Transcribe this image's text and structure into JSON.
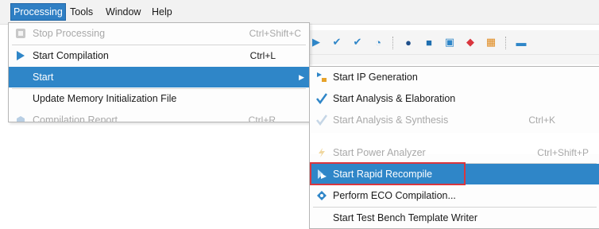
{
  "menubar": {
    "items": [
      "Processing",
      "Tools",
      "Window",
      "Help"
    ]
  },
  "processing_menu": {
    "items": [
      {
        "label": "Stop Processing",
        "shortcut": "Ctrl+Shift+C",
        "icon": "stop-icon",
        "state": "disabled"
      },
      {
        "label": "Start Compilation",
        "shortcut": "Ctrl+L",
        "icon": "play-icon",
        "state": "normal"
      },
      {
        "label": "Start",
        "shortcut": "",
        "icon": "",
        "state": "highlighted",
        "submenu_arrow": "▶"
      },
      {
        "label": "Update Memory Initialization File",
        "shortcut": "",
        "icon": "",
        "state": "normal"
      },
      {
        "label": "Compilation Report",
        "shortcut": "Ctrl+R",
        "icon": "report-icon",
        "state": "disabled"
      }
    ]
  },
  "start_submenu": {
    "items": [
      {
        "label": "Start IP Generation",
        "shortcut": "",
        "icon": "ip-generation-icon",
        "state": "normal"
      },
      {
        "label": "Start Analysis & Elaboration",
        "shortcut": "",
        "icon": "analysis-elaboration-icon",
        "state": "normal"
      },
      {
        "label": "Start Analysis & Synthesis",
        "shortcut": "Ctrl+K",
        "icon": "analysis-synthesis-icon",
        "state": "disabled"
      },
      {
        "label": "Start Power Analyzer",
        "shortcut": "Ctrl+Shift+P",
        "icon": "power-analyzer-icon",
        "state": "disabled"
      },
      {
        "label": "Start Rapid Recompile",
        "shortcut": "",
        "icon": "rapid-recompile-icon",
        "state": "highlighted"
      },
      {
        "label": "Perform ECO Compilation...",
        "shortcut": "",
        "icon": "eco-compilation-icon",
        "state": "normal"
      },
      {
        "label": "Start Test Bench Template Writer",
        "shortcut": "",
        "icon": "",
        "state": "normal"
      }
    ]
  },
  "colors": {
    "highlight": "#2f86c8",
    "menubar_active": "#2f7fc4",
    "callout": "#d9363e",
    "disabled_text": "#a8a8a8"
  }
}
